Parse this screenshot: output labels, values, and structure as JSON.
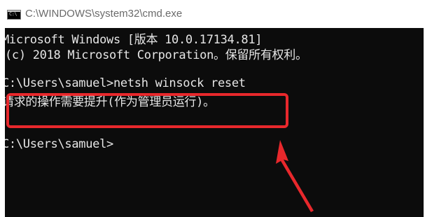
{
  "window": {
    "title": "C:\\WINDOWS\\system32\\cmd.exe",
    "icon": "cmd-icon",
    "icon_prompt": "C:\\"
  },
  "console": {
    "lines": [
      "Microsoft Windows [版本 10.0.17134.81]",
      "(c) 2018 Microsoft Corporation。保留所有权利。",
      "C:\\Users\\samuel>netsh winsock reset",
      "请求的操作需要提升(作为管理员运行)。",
      "C:\\Users\\samuel>"
    ]
  },
  "annotation": {
    "highlight_color": "#e8282c",
    "arrow_color": "#e8282c"
  },
  "colors": {
    "console_background": "#0c0c0c",
    "console_text": "#e6e6e6",
    "title_text": "#6a6a6a"
  }
}
